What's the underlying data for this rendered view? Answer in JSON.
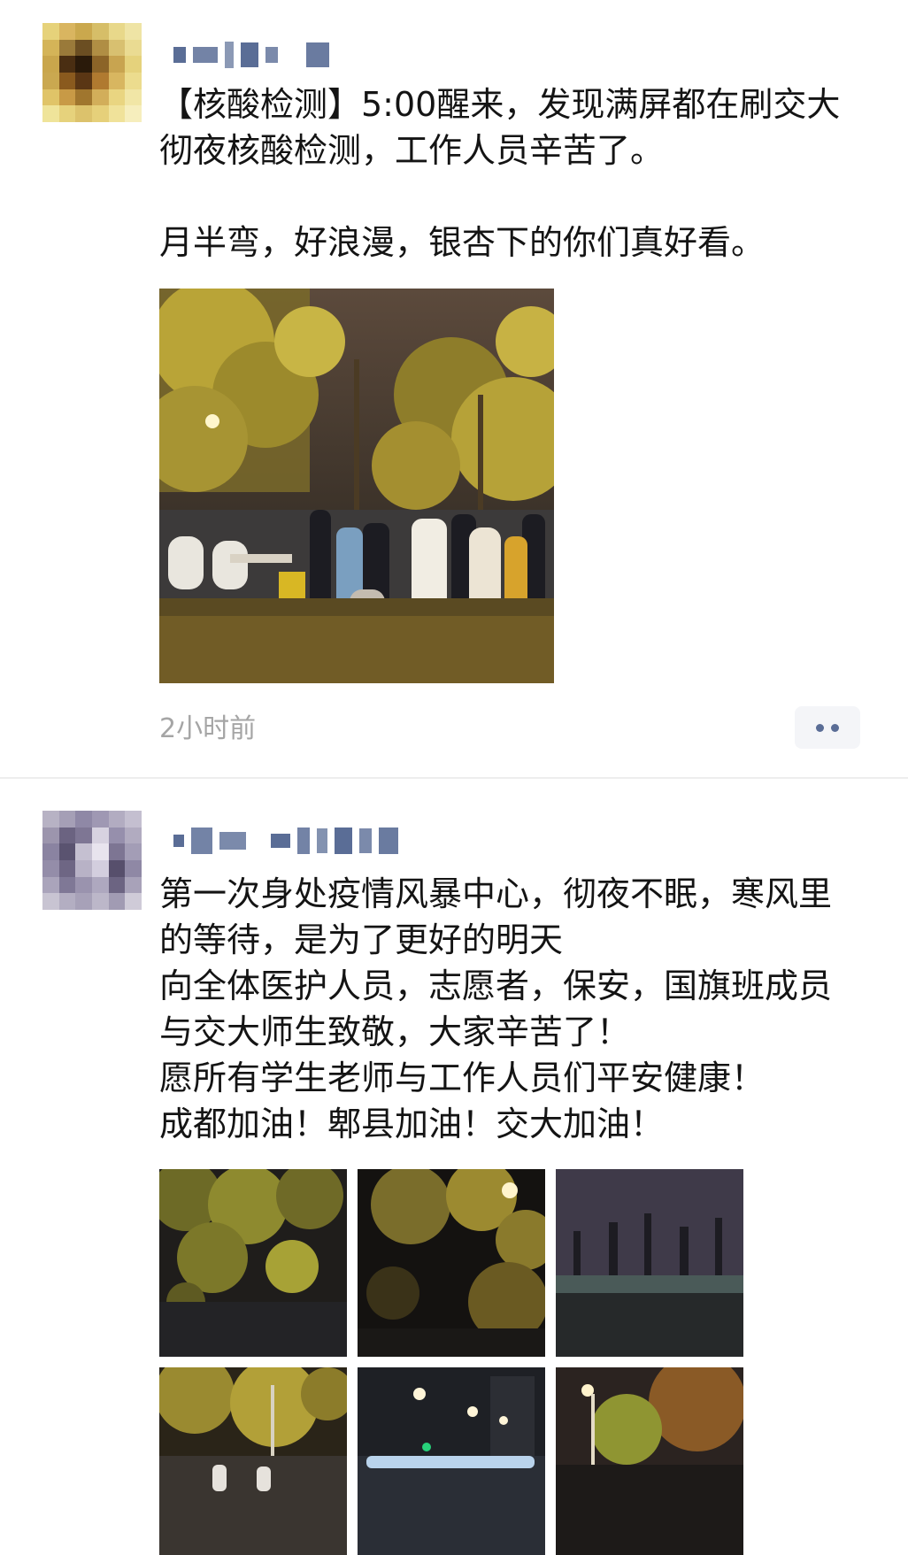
{
  "posts": [
    {
      "text": "【核酸检测】5:00醒来，发现满屏都在刷交大彻夜核酸检测，工作人员辛苦了。\n\n月半弯，好浪漫，银杏下的你们真好看。",
      "timestamp": "2小时前",
      "photo_count": 1,
      "avatar_blurred": true,
      "username_blurred": true
    },
    {
      "text": "第一次身处疫情风暴中心，彻夜不眠，寒风里的等待，是为了更好的明天\n向全体医护人员，志愿者，保安，国旗班成员与交大师生致敬，大家辛苦了！\n愿所有学生老师与工作人员们平安健康！\n成都加油！郫县加油！交大加油！",
      "photo_count": 6,
      "avatar_blurred": true,
      "username_blurred": true
    }
  ],
  "icons": {
    "more": "more-dots-icon"
  },
  "colors": {
    "link_blue": "#5a6d96",
    "timestamp_gray": "#a5a5a5",
    "divider": "#ededed"
  }
}
